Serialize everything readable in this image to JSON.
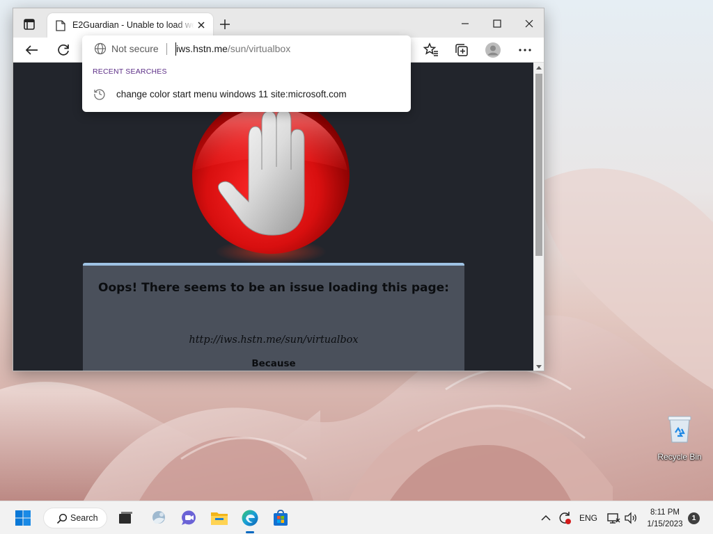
{
  "browser": {
    "tab": {
      "title": "E2Guardian - Unable to load web page"
    },
    "address_bar": {
      "security_label": "Not secure",
      "url_host": "iws.hstn.me",
      "url_path": "/sun/virtualbox"
    },
    "dropdown": {
      "section_heading": "RECENT SEARCHES",
      "suggestions": [
        {
          "text": "change color start menu windows 11 site:microsoft.com",
          "icon": "history-icon"
        }
      ]
    }
  },
  "page": {
    "error_title": "Oops! There seems to be an issue loading this page:",
    "error_url": "http://iws.hstn.me/sun/virtualbox",
    "error_because": "Because",
    "colors": {
      "background": "#22252c",
      "panel": "#4a505b",
      "panel_accent": "#9fc3e4",
      "stop_sign": "#e01616"
    }
  },
  "desktop": {
    "icons": [
      {
        "label": "Recycle Bin",
        "icon": "recycle-bin-icon"
      }
    ]
  },
  "taskbar": {
    "search_label": "Search",
    "apps": [
      "start-icon",
      "search-icon",
      "task-view-icon",
      "widgets-icon",
      "chat-icon",
      "file-explorer-icon",
      "edge-icon",
      "store-icon"
    ],
    "language": "ENG",
    "time": "8:11 PM",
    "date": "1/15/2023",
    "notification_count": "1"
  }
}
